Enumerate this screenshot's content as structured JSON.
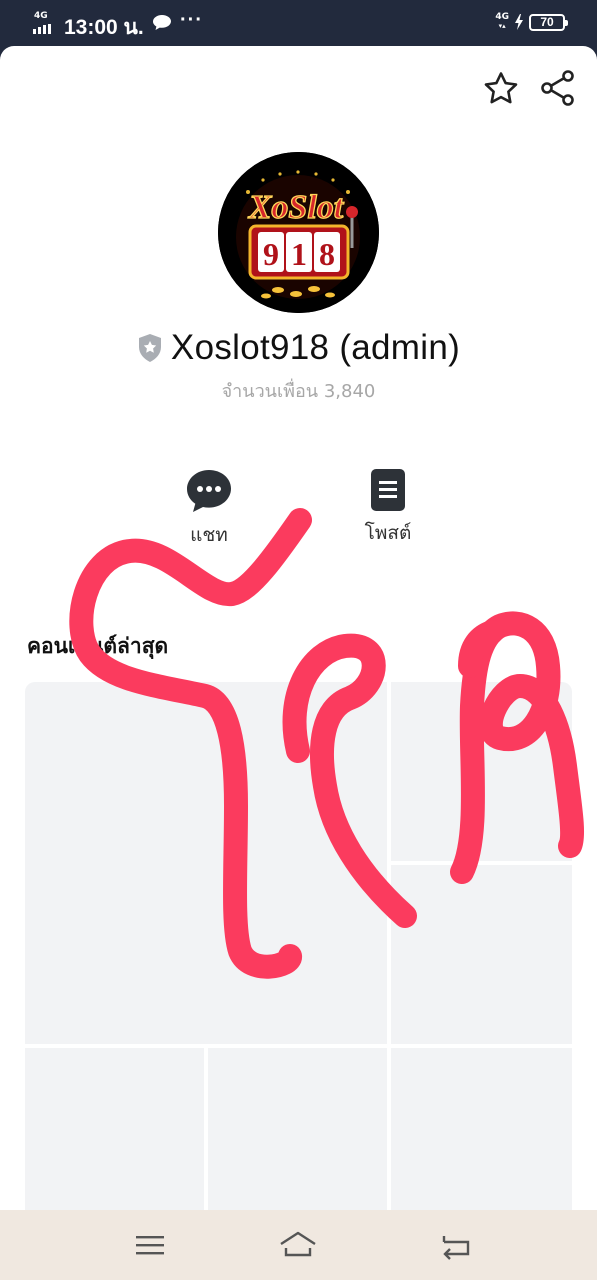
{
  "status_bar": {
    "network_left": "4G",
    "time": "13:00 น.",
    "more_dots": "···",
    "network_right": "4G",
    "battery": "70"
  },
  "header": {
    "star_icon": "star-outline-icon",
    "share_icon": "share-icon"
  },
  "profile": {
    "name": "Xoslot918 (admin)",
    "friends": "จำนวนเพื่อน 3,840",
    "badge_icon": "shield-badge-icon",
    "logo_text": "XoSlot 918"
  },
  "actions": {
    "chat_label": "แชท",
    "post_label": "โพสต์"
  },
  "content": {
    "section_title": "คอนเทนต์ล่าสุด"
  },
  "nav": {
    "menu_icon": "menu-icon",
    "home_icon": "home-icon",
    "back_icon": "back-icon",
    "background": "#f0e8e0"
  },
  "colors": {
    "status_bar": "#222a3d",
    "scribble": "#fb3b5e",
    "tile": "#f2f3f5",
    "muted_text": "#a7a7a7"
  }
}
